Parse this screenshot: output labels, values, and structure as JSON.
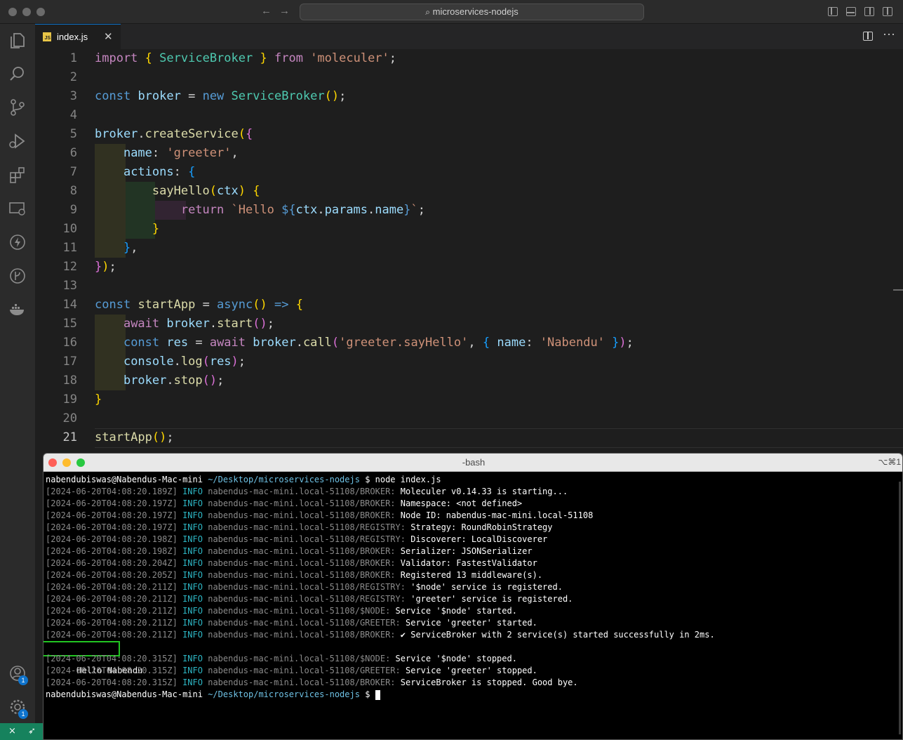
{
  "window": {
    "search_text": "microservices-nodejs"
  },
  "tab": {
    "filename": "index.js"
  },
  "editor": {
    "lines": [
      [
        [
          "import",
          "kc"
        ],
        [
          " ",
          ""
        ],
        [
          "{",
          "b1"
        ],
        [
          " ",
          ""
        ],
        [
          "ServiceBroker",
          "c"
        ],
        [
          " ",
          ""
        ],
        [
          "}",
          "b1"
        ],
        [
          " ",
          ""
        ],
        [
          "from",
          "kc"
        ],
        [
          " ",
          ""
        ],
        [
          "'moleculer'",
          "s"
        ],
        [
          ";",
          ""
        ]
      ],
      [],
      [
        [
          "const",
          "k"
        ],
        [
          " ",
          ""
        ],
        [
          "broker",
          "v"
        ],
        [
          " = ",
          ""
        ],
        [
          "new",
          "k"
        ],
        [
          " ",
          ""
        ],
        [
          "ServiceBroker",
          "c"
        ],
        [
          "()",
          "b1"
        ],
        [
          ";",
          ""
        ]
      ],
      [],
      [
        [
          "broker",
          "v"
        ],
        [
          ".",
          ""
        ],
        [
          "createService",
          "f"
        ],
        [
          "(",
          "b1"
        ],
        [
          "{",
          "b2"
        ]
      ],
      [
        [
          "    ",
          ""
        ],
        [
          "name",
          "v"
        ],
        [
          ": ",
          ""
        ],
        [
          "'greeter'",
          "s"
        ],
        [
          ",",
          ""
        ]
      ],
      [
        [
          "    ",
          ""
        ],
        [
          "actions",
          "v"
        ],
        [
          ": ",
          ""
        ],
        [
          "{",
          "b3"
        ]
      ],
      [
        [
          "        ",
          ""
        ],
        [
          "sayHello",
          "f"
        ],
        [
          "(",
          "b1"
        ],
        [
          "ctx",
          "v"
        ],
        [
          ")",
          "b1"
        ],
        [
          " ",
          ""
        ],
        [
          "{",
          "b1"
        ]
      ],
      [
        [
          "            ",
          ""
        ],
        [
          "return",
          "kc"
        ],
        [
          " ",
          ""
        ],
        [
          "`Hello ",
          "s"
        ],
        [
          "${",
          "k"
        ],
        [
          "ctx",
          "v"
        ],
        [
          ".",
          ""
        ],
        [
          "params",
          "v"
        ],
        [
          ".",
          ""
        ],
        [
          "name",
          "v"
        ],
        [
          "}",
          "k"
        ],
        [
          "`",
          "s"
        ],
        [
          ";",
          ""
        ]
      ],
      [
        [
          "        ",
          ""
        ],
        [
          "}",
          "b1"
        ]
      ],
      [
        [
          "    ",
          ""
        ],
        [
          "}",
          "b3"
        ],
        [
          ",",
          ""
        ]
      ],
      [
        [
          "}",
          "b2"
        ],
        [
          ")",
          "b1"
        ],
        [
          ";",
          ""
        ]
      ],
      [],
      [
        [
          "const",
          "k"
        ],
        [
          " ",
          ""
        ],
        [
          "startApp",
          "f"
        ],
        [
          " = ",
          ""
        ],
        [
          "async",
          "k"
        ],
        [
          "()",
          "b1"
        ],
        [
          " ",
          ""
        ],
        [
          "=>",
          "k"
        ],
        [
          " ",
          ""
        ],
        [
          "{",
          "b1"
        ]
      ],
      [
        [
          "    ",
          ""
        ],
        [
          "await",
          "kc"
        ],
        [
          " ",
          ""
        ],
        [
          "broker",
          "v"
        ],
        [
          ".",
          ""
        ],
        [
          "start",
          "f"
        ],
        [
          "()",
          "b2"
        ],
        [
          ";",
          ""
        ]
      ],
      [
        [
          "    ",
          ""
        ],
        [
          "const",
          "k"
        ],
        [
          " ",
          ""
        ],
        [
          "res",
          "v"
        ],
        [
          " = ",
          ""
        ],
        [
          "await",
          "kc"
        ],
        [
          " ",
          ""
        ],
        [
          "broker",
          "v"
        ],
        [
          ".",
          ""
        ],
        [
          "call",
          "f"
        ],
        [
          "(",
          "b2"
        ],
        [
          "'greeter.sayHello'",
          "s"
        ],
        [
          ", ",
          ""
        ],
        [
          "{",
          "b3"
        ],
        [
          " ",
          ""
        ],
        [
          "name",
          "v"
        ],
        [
          ": ",
          ""
        ],
        [
          "'Nabendu'",
          "s"
        ],
        [
          " ",
          ""
        ],
        [
          "}",
          "b3"
        ],
        [
          ")",
          "b2"
        ],
        [
          ";",
          ""
        ]
      ],
      [
        [
          "    ",
          ""
        ],
        [
          "console",
          "v"
        ],
        [
          ".",
          ""
        ],
        [
          "log",
          "f"
        ],
        [
          "(",
          "b2"
        ],
        [
          "res",
          "v"
        ],
        [
          ")",
          "b2"
        ],
        [
          ";",
          ""
        ]
      ],
      [
        [
          "    ",
          ""
        ],
        [
          "broker",
          "v"
        ],
        [
          ".",
          ""
        ],
        [
          "stop",
          "f"
        ],
        [
          "()",
          "b2"
        ],
        [
          ";",
          ""
        ]
      ],
      [
        [
          "}",
          "b1"
        ]
      ],
      [],
      [
        [
          "startApp",
          "f"
        ],
        [
          "()",
          "b1"
        ],
        [
          ";",
          ""
        ]
      ]
    ]
  },
  "terminal": {
    "title": "-bash",
    "shortcut": "⌥⌘1",
    "prompt_user": "nabendubiswas@Nabendus-Mac-mini",
    "prompt_path": "~/Desktop/microservices-nodejs",
    "command": "$ node index.js",
    "prompt_end": "$",
    "logs_a": [
      {
        "ts": "[2024-06-20T04:08:20.189Z]",
        "lvl": "INFO",
        "mod": "nabendus-mac-mini.local-51108/BROKER:",
        "msg": "Moleculer v0.14.33 is starting..."
      },
      {
        "ts": "[2024-06-20T04:08:20.197Z]",
        "lvl": "INFO",
        "mod": "nabendus-mac-mini.local-51108/BROKER:",
        "msg": "Namespace: <not defined>"
      },
      {
        "ts": "[2024-06-20T04:08:20.197Z]",
        "lvl": "INFO",
        "mod": "nabendus-mac-mini.local-51108/BROKER:",
        "msg": "Node ID: nabendus-mac-mini.local-51108"
      },
      {
        "ts": "[2024-06-20T04:08:20.197Z]",
        "lvl": "INFO",
        "mod": "nabendus-mac-mini.local-51108/REGISTRY:",
        "msg": "Strategy: RoundRobinStrategy"
      },
      {
        "ts": "[2024-06-20T04:08:20.198Z]",
        "lvl": "INFO",
        "mod": "nabendus-mac-mini.local-51108/REGISTRY:",
        "msg": "Discoverer: LocalDiscoverer"
      },
      {
        "ts": "[2024-06-20T04:08:20.198Z]",
        "lvl": "INFO",
        "mod": "nabendus-mac-mini.local-51108/BROKER:",
        "msg": "Serializer: JSONSerializer"
      },
      {
        "ts": "[2024-06-20T04:08:20.204Z]",
        "lvl": "INFO",
        "mod": "nabendus-mac-mini.local-51108/BROKER:",
        "msg": "Validator: FastestValidator"
      },
      {
        "ts": "[2024-06-20T04:08:20.205Z]",
        "lvl": "INFO",
        "mod": "nabendus-mac-mini.local-51108/BROKER:",
        "msg": "Registered 13 middleware(s)."
      },
      {
        "ts": "[2024-06-20T04:08:20.211Z]",
        "lvl": "INFO",
        "mod": "nabendus-mac-mini.local-51108/REGISTRY:",
        "msg": "'$node' service is registered."
      },
      {
        "ts": "[2024-06-20T04:08:20.211Z]",
        "lvl": "INFO",
        "mod": "nabendus-mac-mini.local-51108/REGISTRY:",
        "msg": "'greeter' service is registered."
      },
      {
        "ts": "[2024-06-20T04:08:20.211Z]",
        "lvl": "INFO",
        "mod": "nabendus-mac-mini.local-51108/$NODE:",
        "msg": "Service '$node' started."
      },
      {
        "ts": "[2024-06-20T04:08:20.211Z]",
        "lvl": "INFO",
        "mod": "nabendus-mac-mini.local-51108/GREETER:",
        "msg": "Service 'greeter' started."
      },
      {
        "ts": "[2024-06-20T04:08:20.211Z]",
        "lvl": "INFO",
        "mod": "nabendus-mac-mini.local-51108/BROKER:",
        "msg": "✔ ServiceBroker with 2 service(s) started successfully in 2ms."
      }
    ],
    "hello_output": "Hello Nabendu",
    "logs_b": [
      {
        "ts": "[2024-06-20T04:08:20.315Z]",
        "lvl": "INFO",
        "mod": "nabendus-mac-mini.local-51108/$NODE:",
        "msg": "Service '$node' stopped."
      },
      {
        "ts": "[2024-06-20T04:08:20.315Z]",
        "lvl": "INFO",
        "mod": "nabendus-mac-mini.local-51108/GREETER:",
        "msg": "Service 'greeter' stopped."
      },
      {
        "ts": "[2024-06-20T04:08:20.315Z]",
        "lvl": "INFO",
        "mod": "nabendus-mac-mini.local-51108/BROKER:",
        "msg": "ServiceBroker is stopped. Good bye."
      }
    ]
  },
  "activity": {
    "accounts_badge": "1",
    "settings_badge": "1"
  },
  "colors": {
    "accent": "#0e73cc",
    "status_bar": "#16825d",
    "highlight_box": "#22c522"
  }
}
